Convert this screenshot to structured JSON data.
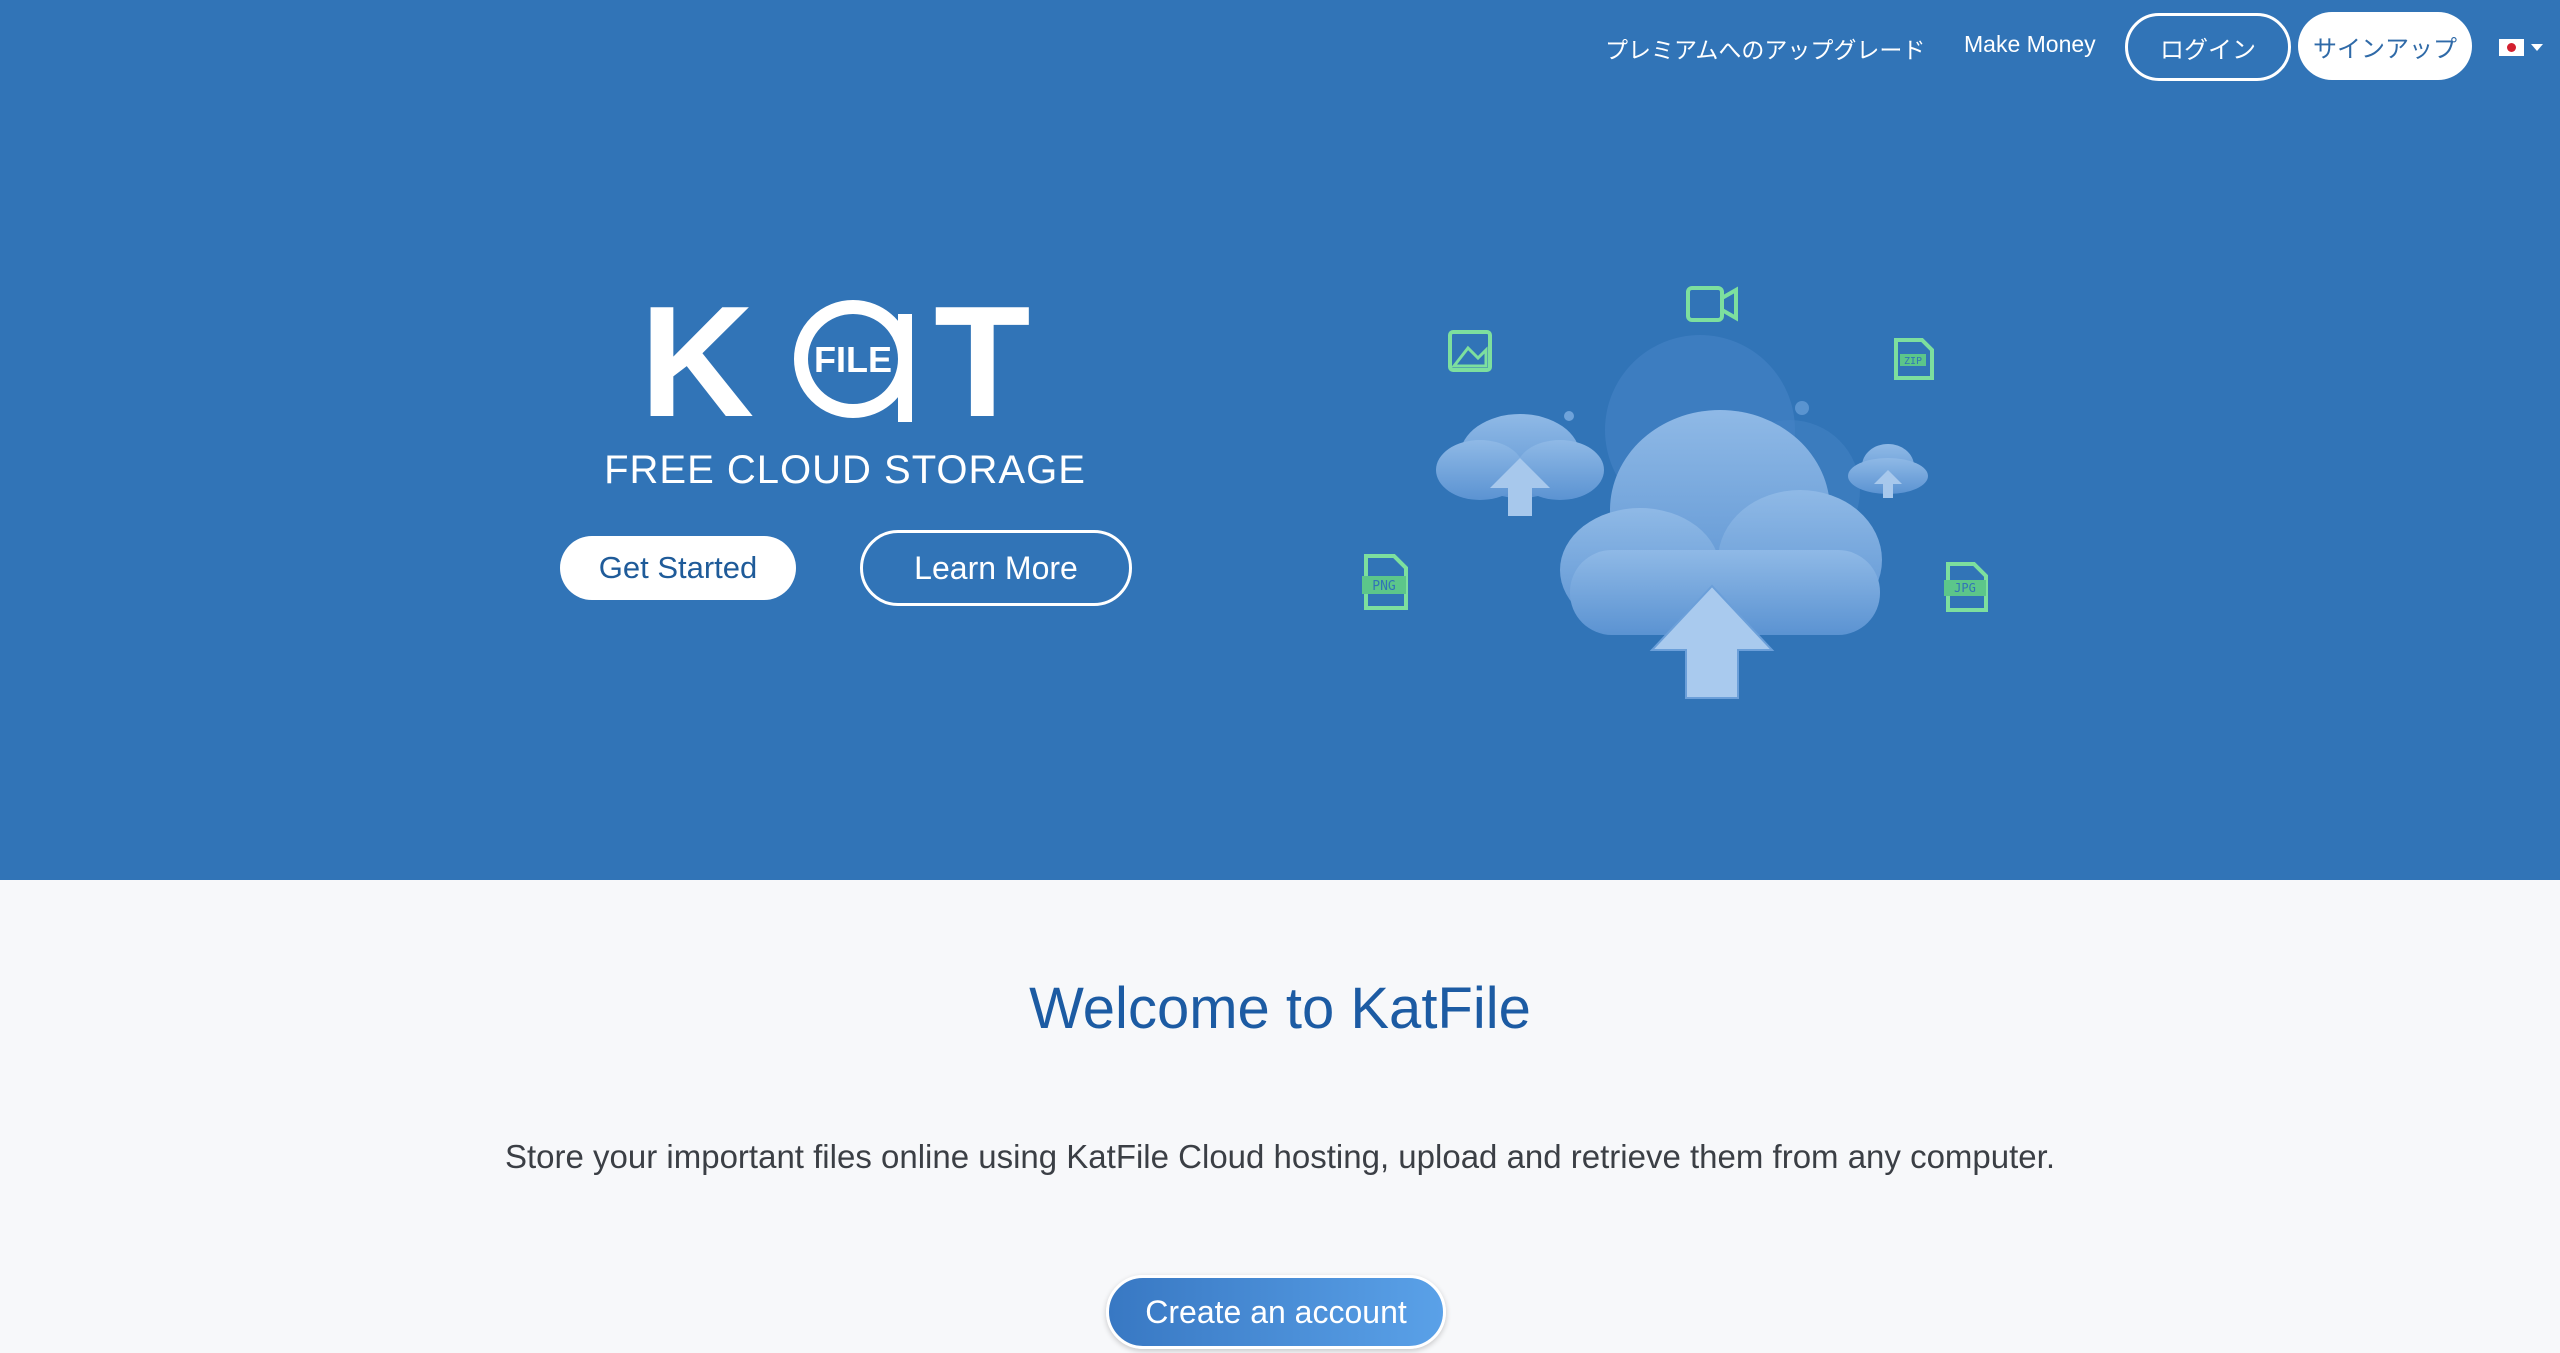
{
  "nav": {
    "upgrade": "プレミアムへのアップグレード",
    "make_money": "Make Money",
    "login": "ログイン",
    "signup": "サインアップ",
    "language_icon": "japan-flag-icon"
  },
  "hero": {
    "logo_letters": {
      "k": "K",
      "a_inner": "FILE",
      "t": "T"
    },
    "tagline": "FREE CLOUD STORAGE",
    "get_started": "Get Started",
    "learn_more": "Learn More",
    "file_badges": {
      "png": "PNG",
      "jpg": "JPG",
      "zip": "ZIP"
    }
  },
  "main": {
    "welcome": "Welcome to KatFile",
    "description": "Store your important files online using KatFile Cloud hosting, upload and retrieve them from any computer.",
    "create_account": "Create an account"
  },
  "colors": {
    "hero_bg": "#3174b7",
    "page_bg": "#f7f8fa",
    "heading": "#1c5ba3",
    "icon_green": "#7ddf9e"
  }
}
